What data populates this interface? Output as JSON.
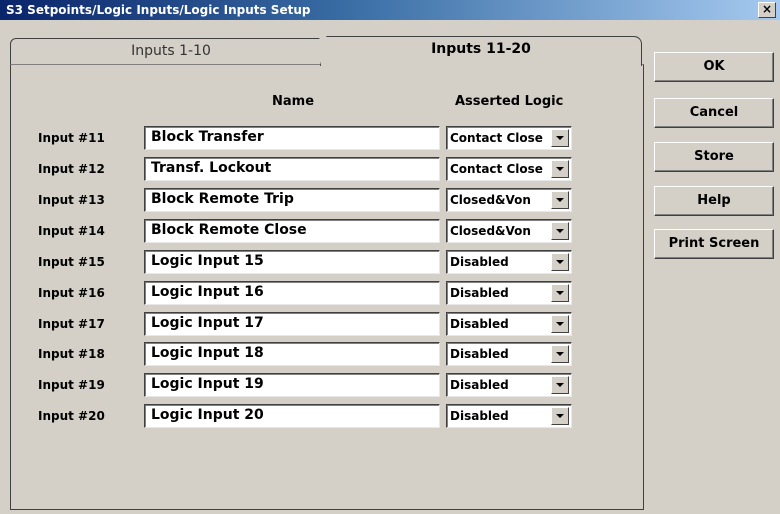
{
  "window": {
    "title": "S3 Setpoints/Logic Inputs/Logic Inputs Setup",
    "close_glyph": "×"
  },
  "tabs": [
    {
      "label": "Inputs 1-10",
      "active": false
    },
    {
      "label": "Inputs 11-20",
      "active": true
    }
  ],
  "columns": {
    "name": "Name",
    "asserted_logic": "Asserted Logic"
  },
  "inputs": [
    {
      "label": "Input #11",
      "name": "Block Transfer",
      "logic": "Contact Close"
    },
    {
      "label": "Input #12",
      "name": "Transf. Lockout",
      "logic": "Contact Close"
    },
    {
      "label": "Input #13",
      "name": "Block Remote Trip",
      "logic": "Closed&Von"
    },
    {
      "label": "Input #14",
      "name": "Block Remote Close",
      "logic": "Closed&Von"
    },
    {
      "label": "Input #15",
      "name": "Logic Input 15",
      "logic": "Disabled"
    },
    {
      "label": "Input #16",
      "name": "Logic Input 16",
      "logic": "Disabled"
    },
    {
      "label": "Input #17",
      "name": "Logic Input 17",
      "logic": "Disabled"
    },
    {
      "label": "Input #18",
      "name": "Logic Input 18",
      "logic": "Disabled"
    },
    {
      "label": "Input #19",
      "name": "Logic Input 19",
      "logic": "Disabled"
    },
    {
      "label": "Input #20",
      "name": "Logic Input 20",
      "logic": "Disabled"
    }
  ],
  "buttons": {
    "ok": "OK",
    "cancel": "Cancel",
    "store": "Store",
    "help": "Help",
    "print_screen": "Print Screen"
  },
  "colors": {
    "titlebar_start": "#0a246a",
    "titlebar_end": "#a6caf0",
    "face": "#d4d0c8"
  }
}
